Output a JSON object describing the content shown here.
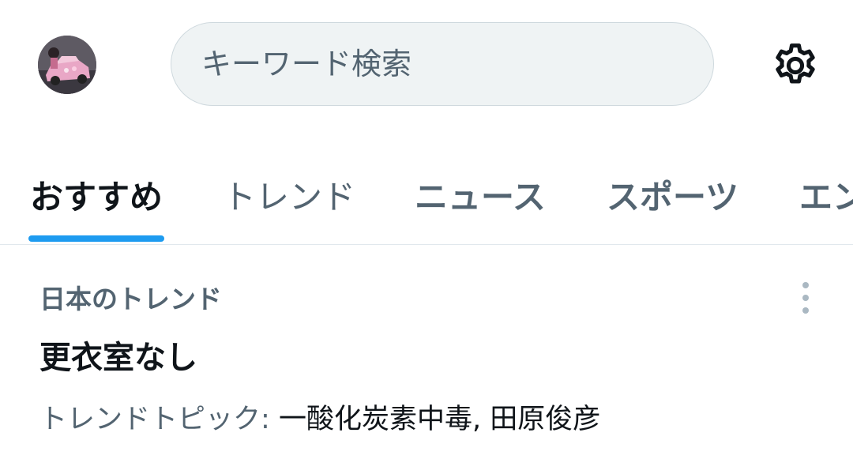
{
  "header": {
    "search_placeholder": "キーワード検索",
    "avatar_icon": "user-avatar-icon",
    "settings_icon": "gear-icon"
  },
  "tabs": [
    {
      "label": "おすすめ",
      "active": true
    },
    {
      "label": "トレンド",
      "active": false
    },
    {
      "label": "ニュース",
      "active": false
    },
    {
      "label": "スポーツ",
      "active": false
    },
    {
      "label": "エンタメ",
      "active": false
    }
  ],
  "trend": {
    "category": "日本のトレンド",
    "title": "更衣室なし",
    "topics_label": "トレンドトピック:",
    "topics": "一酸化炭素中毒, 田原俊彦",
    "more_icon": "more-vertical-icon"
  },
  "colors": {
    "accent": "#1d9bf0",
    "text_primary": "#0f1419",
    "text_secondary": "#536471",
    "search_bg": "#eff3f4",
    "border": "#e1e8ed"
  }
}
